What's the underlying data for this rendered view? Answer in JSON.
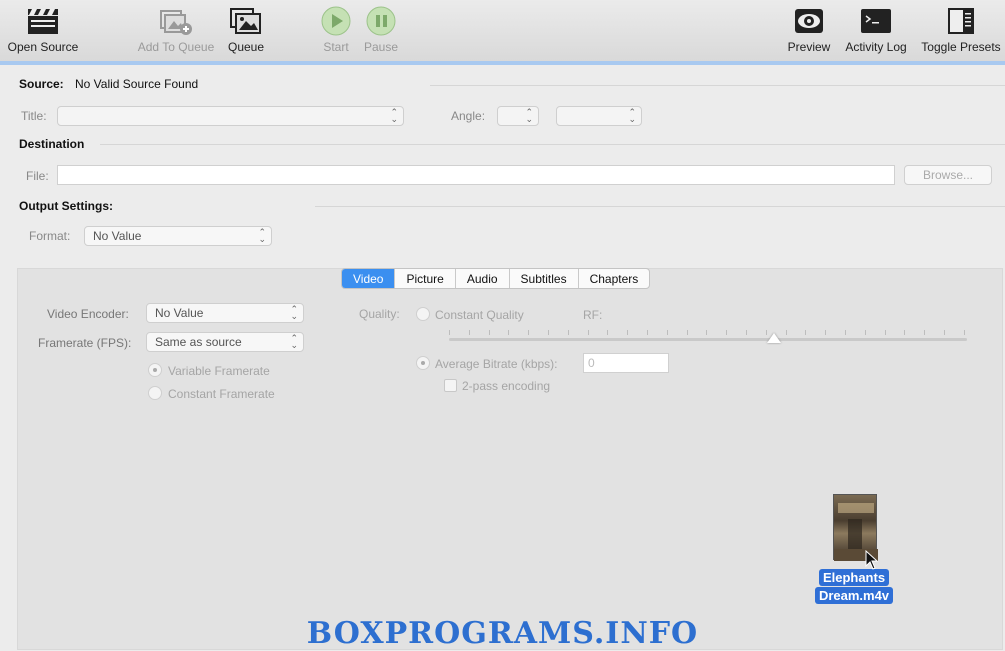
{
  "toolbar": {
    "open_source": "Open Source",
    "add_to_queue": "Add To Queue",
    "queue": "Queue",
    "start": "Start",
    "pause": "Pause",
    "preview": "Preview",
    "activity_log": "Activity Log",
    "toggle_presets": "Toggle Presets"
  },
  "source": {
    "label": "Source:",
    "value": "No Valid Source Found",
    "title_label": "Title:",
    "angle_label": "Angle:"
  },
  "destination": {
    "heading": "Destination",
    "file_label": "File:",
    "browse": "Browse..."
  },
  "output": {
    "heading": "Output Settings:",
    "format_label": "Format:",
    "format_value": "No Value"
  },
  "tabs": [
    "Video",
    "Picture",
    "Audio",
    "Subtitles",
    "Chapters"
  ],
  "video": {
    "encoder_label": "Video Encoder:",
    "encoder_value": "No Value",
    "framerate_label": "Framerate (FPS):",
    "framerate_value": "Same as source",
    "variable_framerate": "Variable Framerate",
    "constant_framerate": "Constant Framerate",
    "quality_label": "Quality:",
    "constant_quality": "Constant Quality",
    "rf_label": "RF:",
    "average_bitrate": "Average Bitrate (kbps):",
    "bitrate_value": "0",
    "two_pass": "2-pass encoding"
  },
  "drag_file": {
    "name_line1": "Elephants",
    "name_line2": "Dream.m4v"
  },
  "watermark": "BOXPROGRAMS.INFO",
  "colors": {
    "accent": "#3b8ff0",
    "toolbar_accent": "#a8c9f0",
    "watermark": "#2d6fd0"
  }
}
